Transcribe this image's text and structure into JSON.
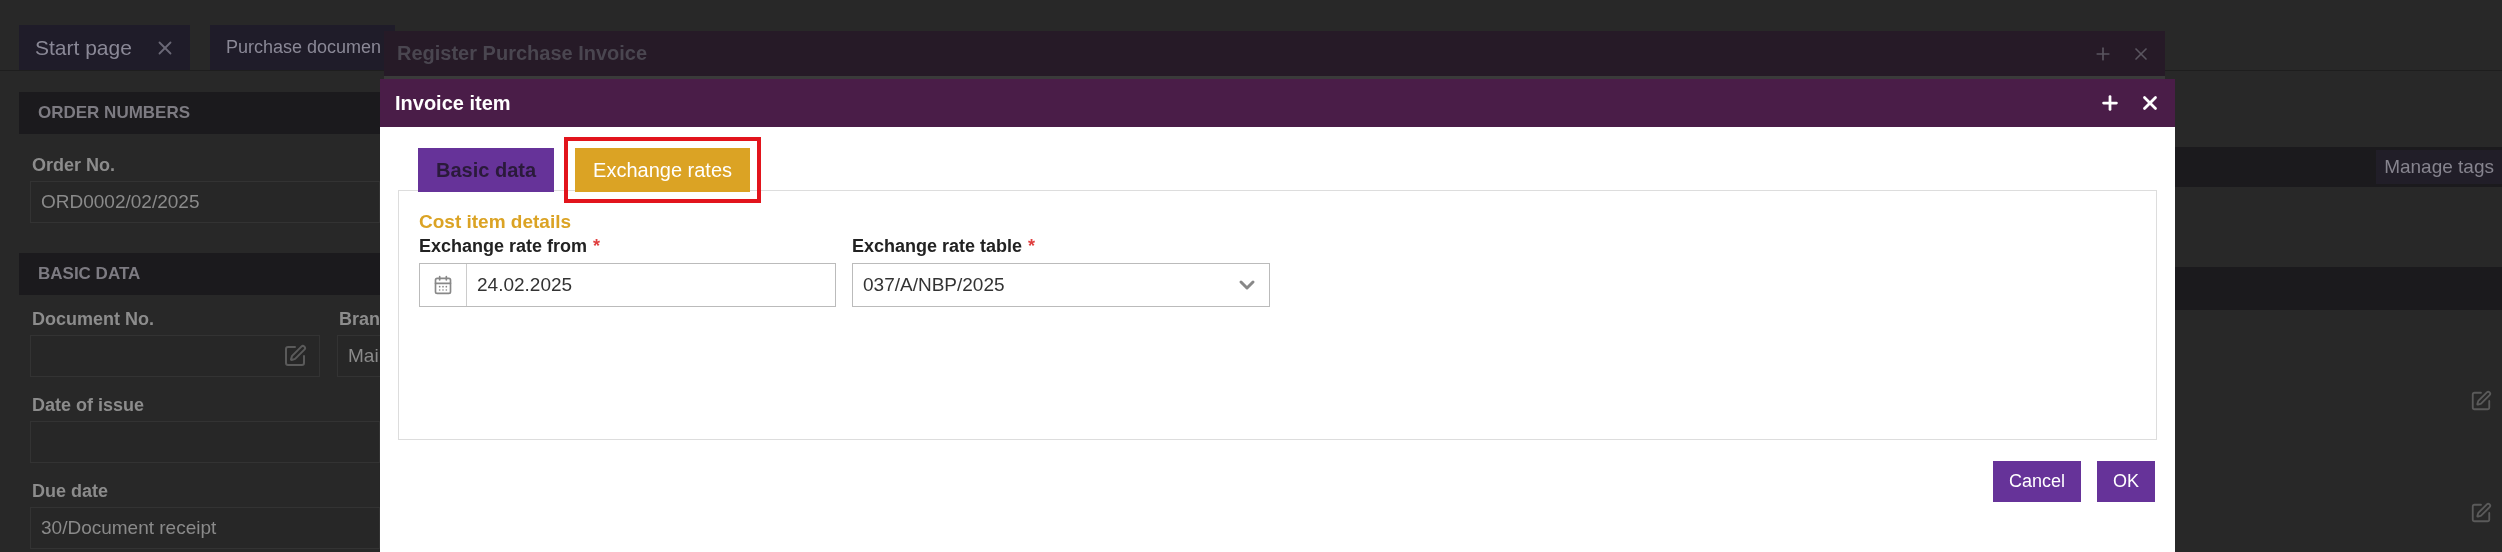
{
  "background": {
    "tabs": [
      {
        "label": "Start page",
        "closable": true
      },
      {
        "label": "Purchase documen",
        "closable": false
      }
    ],
    "order_numbers": {
      "title": "ORDER NUMBERS",
      "order_no": {
        "label": "Order No.",
        "value": "ORD0002/02/2025"
      }
    },
    "basic_data": {
      "title": "BASIC DATA",
      "document_no": {
        "label": "Document No."
      },
      "branch": {
        "label": "Bran",
        "value": "Mai"
      },
      "date_of_issue": {
        "label": "Date of issue"
      },
      "due_date": {
        "label": "Due date",
        "value": "30/Document receipt"
      }
    },
    "right_panel": {
      "manage_tags_button": "Manage tags"
    }
  },
  "dialog": {
    "title": "Register Purchase Invoice"
  },
  "item_dialog": {
    "title": "Invoice item",
    "tabs": [
      {
        "label": "Basic data",
        "selected": false,
        "highlighted": false
      },
      {
        "label": "Exchange rates",
        "selected": true,
        "highlighted": true
      }
    ],
    "section_title": "Cost item details",
    "fields": [
      {
        "kind": "date",
        "label": "Exchange rate from",
        "required_mark": "*",
        "value": "24.02.2025"
      },
      {
        "kind": "select",
        "label": "Exchange rate table",
        "required_mark": "*",
        "value": "037/A/NBP/2025"
      }
    ],
    "buttons": [
      "Cancel",
      "OK"
    ]
  }
}
